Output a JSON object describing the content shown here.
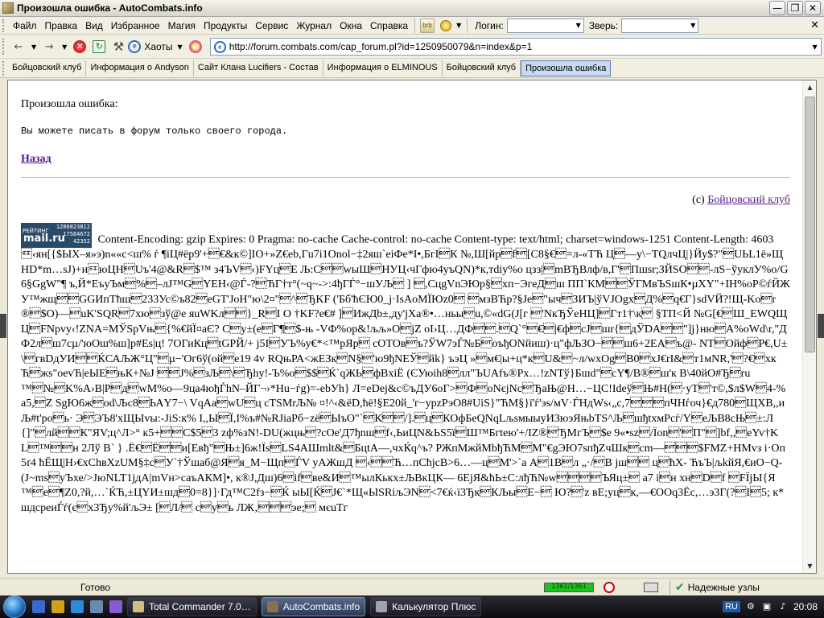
{
  "window": {
    "title": "Произошла ошибка - AutoCombats.info",
    "controls": {
      "minimize": "—",
      "maximize": "❐",
      "close": "✕"
    }
  },
  "menubar": {
    "items": [
      "Файл",
      "Правка",
      "Вид",
      "Избранное",
      "Магия",
      "Продукты",
      "Сервис",
      "Журнал",
      "Окна",
      "Справка"
    ],
    "brb_label": "brb",
    "login_label": "Логин:",
    "login_value": "",
    "beast_label": "Зверь:",
    "beast_value": "",
    "close_glyph": "✕"
  },
  "navbar": {
    "back_glyph": "←",
    "forward_glyph": "→",
    "stop_glyph": "✕",
    "refresh_glyph": "↻",
    "tools_glyph": "⚒",
    "haoty_label": "Хаоты",
    "address": "http://forum.combats.com/cap_forum.pl?id=1250950079&n=index&p=1"
  },
  "tabs": [
    {
      "label": "Бойцовский клуб",
      "active": false
    },
    {
      "label": "Информация о Andyson",
      "active": false
    },
    {
      "label": "Сайт Клана Lucifiers - Состав",
      "active": false
    },
    {
      "label": "Информация о ELMINOUS",
      "active": false
    },
    {
      "label": "Бойцовский клуб",
      "active": false
    },
    {
      "label": "Произошла ошибка",
      "active": true
    }
  ],
  "page": {
    "error_title": "Произошла ошибка:",
    "error_message": "Вы можете писать в форум только своего города.",
    "back_link": "Назад",
    "copyright_prefix": "(c)",
    "copyright_link": "Бойцовский клуб",
    "counter": {
      "top_label": "РЕЙТИНГ",
      "brand": "mail.ru",
      "numbers": [
        "1286823812",
        "17584672",
        "42352"
      ]
    },
    "raw_output": "Content-Encoding: gzip Expires: 0 Pragma: no-cache Cache-control: no-cache Content-type: text/html; charset=windows-1251 Content-Length: 4603 \u000f‹ян[{$ЫХ–я»э)n««с<ш% ѓ ¶іЦ#ёр9'+\u0004€&к©]IO+»Z€eb,Гu7i1Onol−‡2яш`еіФе*І•,БгІ\u0004К №,Ш[йр\u0004f\u0004[С8§€\u0004=л-«ТЋ Ц\u0004—у\\−ТQлчЦ|}Йу$?\"\u0004UЬL1ё»ЩHD*m…sJ)+и\u000fюЦН\u0004Uъ'4@&R\u0004$™ з4ЪV\u0004‹)FYц\u0004Е Љ:С\u0004\u0004wыШ\u0004НУЦ‹чГфю4уъQN)*к,тdiy%о цзз|\u0004mВЂВлф/в,Г'\u0004Пшsr;ЗЙSO\u0004\u0004-лS−ўуклУ%о/G6§GgW\"¶ ъ,Й*ЕъуЪм\u0004%\u0004–лJ™G\u0004YEH‹@Ѓ-?\u0004ЋГ†т°(~q~->:4ђГЃ°−шУЉ\u0004 ] \u0004,CцgVnЭЮр§\u0004хп−ЭгеД\u0004ш ПП`КМ\u0004\u0004ЎГМвЪSшК•µXY\"+IН%oР©ѓЙЖУ™жщ\u0004\u0004GGИпТћш\u0004233Ус©ъ82\u0004eGТ'JoН\"ю\\2¤\"\u0004^\u0004ЂKF ('Бб'ћЄЮ0_j·IsAoМЇЮz0\u0004 \u0004мзВЋр?§Je\u0004\"ыч\u0004ЗИЪ|ўVJOgx\u0004Д%\u0004q€Г}sdVЙ?!Щ-Ko\u0004r®\u0004$O)—\u0004uK'SQR\u00047хю\u0004зў@е яuWKл\u0004\u0004}_R\u0004I O †KF?е€# ]\u0004ИжДb±,ду'jХа®•…ньы\u0004u,©«dG(J[г \u0004'NкЂЎеНЦ]\u0004Гт1†\\к\u0004 §ТП<Й №G[€\u0004Ш_EWQЩЦ\u0004FNрvy‹!ZNA=МЎSрVњ\u0004{%€йЇ¤аЄ? С\u0004у±(е\u0004Г¶\u0004$-њ -VФ%ор&!љљ»О\u0004jZ oI›Ц…ДФ\u0004\u0004.\u0004Q`°\u0004€\u0004|€ф\u0004cJ\u0004шr{\u0004дЎDA\u0004\u0004\"]j}ню\u0004А%оWd\\r,\"ДФ2л\u0004ш7сµ/'юОш%ш]р#Es|ц! 7OГиКц\u0004tGРЙ/+ j5I\u0004УЪ%у€*<™рЯр\u0004 сОТОв\u0004ъ?ЎW7эЃ№Б\u0004оъђОNйиш)·ц\"фЉЗО−\u0004\u0004ш6+2ЕА\u0004ъ@- NT\u0004Ойф\u0004Р€,U±\\\u0004гвDдУИ\u0004\u0004ЌСАЉЖ°Ц\"\u0004µ−'Ог6ў(ой\u0004е19 4v RQњРА<жЕЗк\u0004N§\u0004'ю9ђNЕЎ\u0004йk} ъэЦ »\u0004м€|ы+ц*к\u0004U&\u0004~л/wxOg\u0004В0\u0004хЈ€rI&\u0004т1мNR,'\u0004?€\u0004хкЋ\u0004жs\"oevЋ|еЫЕ\u0004њК+№J \u0004\u0004J%\u0004зЉ\u0004\\\u0004Ђhy!-Ъ%о\u0004$$\u0004Ќ`qЖЬ\u0004фBxiЁ (ЄУюih8\u0004лл\"ЪUAfъ®Рх…!zNTў}Бшd\"\u0004cY¶/В®\u0004ш'к В\\40йО#Ђ\u0004ru™\u0004№\u0004K%А›В|Р\u0004д\u0004wM%о—9ца4юђЃhN–ЙГ¬›*Hu−ѓg)=-ebУh} Л=eDej&c©ъДУ6oГ>\u0004Ф\u0004оNєjNc\u0004ЂаЊ@Н…−ЦС!Ideў\u0004Њ#Н(\u0004·уТ\u0004'т©,$л$W\u00044-%а5,\u0004Z SgЮ6ж\u0004оd\\Љс8\u0004ЬАY7−\\ VqAa\u0004wU\u0004ц cTSMrЉ№ ¤!^‹&ёD,ћё!§Е20й_'г−урzРэО8#UiS}\"ЋМ§}ї'ѓ'эs/мV·ЃНдWs‹„с,7\u0004\u0004\u0004пЧНѓоч}€д780\u0004ЩХВ,,иЉ#t'ро\u0004ь· Э\u0004ЭЪ8'хЩЫvы:-JiS:к% I,,Ы\u0004Ї,І%ъ#№RJiaРб−zё\u0004ЫъO\"`\u0004К\u0004\u0004/].\u0004ц\u0004КОфБеQNqLљsмыыуИЗюэЯњbTS^Љ\u0004шђtxмРсѓ/Y\u0004еЉВ8сЊ\u0004±:Л{]\"\u0004лй\u0004\u0004К\"ЯV;ц^Л>° к5+\u0004\u0004С$5\u00043 zф%зN!-DU(жцњ\u0004?сOe'Д7ђnш\u0004f‹,ЬиЦN&ЬS5ї\u0004Ш™Бгtею'+/IZ®\u0004ЂМгЪ\u0004$е 9«•sz\u0004/Їon\u0004'\u0004П\"\u0004]bf,,\u0004eYv†KL\u0004™\u0004\u0004н 2Лў В` } .Ё€\u0004Ё\u0004\u0004и[Евђ\"\u0004Њ±]6ж!Їs\u0004LS4AШmlt&\u0004БцtА—,чхЌq^ъ? РЖпМжйМbђЋМ\u0004М\"€gЭЮ7sпђZчШк\u0004сm—\u0004\u0004\u0004$FMZ+HМvз і·Оп5ґ4 ћЁЩ|Н›€хСhвXzUM§‡с\u0004У`†Ўшаб@Я\u0004я_М−Щп\u0004ЃV уАЖшД \u0004‹\u0004\u0004Ћ…пСћјсВ>6…—ц\u0004М'>`а А\u00041В\u0004л „·/\u0004В jш\u0004\u0004 ц\u0004ћХ- ЋъЪ|љkйЯ,€иО−Q-(J~ms\u0004уЪхе/>JюNLT1jдА|mVн>саъАКМ]•, к®J,Дш)6\u0004if\u0004ве&И\u0004™ылКькх±ЉВкЦК— 6ЕјЯ&ћЬ±С:лђЋ№w\u0004\u0004\u0004\u0004ЪЯц±\u0004 а7 i\u0004н хн\u0004D\u0004f \u0004FЇjЫ{Я™\u0004е\u0004¶Z0,?й,…`ЌЋ,±ЦYИ±шд\u00040=8}]·Гд™С2fз−\u0004Ќ ыЫ[Ќ\u0004Ј€`*Щ«ЫЅRiљЭN\u0004<7€ќ‹ї3Ђк\u0004КЉы\u0004Е−\u0004 Ю?\u0004'z вЕ;уц\u0004к,—€ООq3Ёс,…э3Г(?\u0004І\u00045; к*шдсреиЃѓ(є\u0004х3Ђу%й'љЭ± [\u0004Л/\u0004 с\u0004у\u0004ь ЛЖ‚\u0004\u0004\u0004эе;\u0004 мєuТг"
  },
  "statusbar": {
    "status_text": "Готово",
    "progress_percent": 100,
    "progress_text": "1361/1361",
    "zone_text": "Надежные узлы"
  },
  "taskbar": {
    "tasks": [
      {
        "label": "Total Commander 7.0…",
        "active": false
      },
      {
        "label": "AutoCombats.info",
        "active": true
      },
      {
        "label": "Калькулятор Плюс",
        "active": false
      }
    ],
    "language": "RU",
    "clock": "20:08"
  },
  "colors": {
    "link_visited": "#551a8b",
    "active_tab": "#c8d8ee",
    "progress_fill": "#20c020",
    "taskbar_bg": "#0c0c12"
  }
}
